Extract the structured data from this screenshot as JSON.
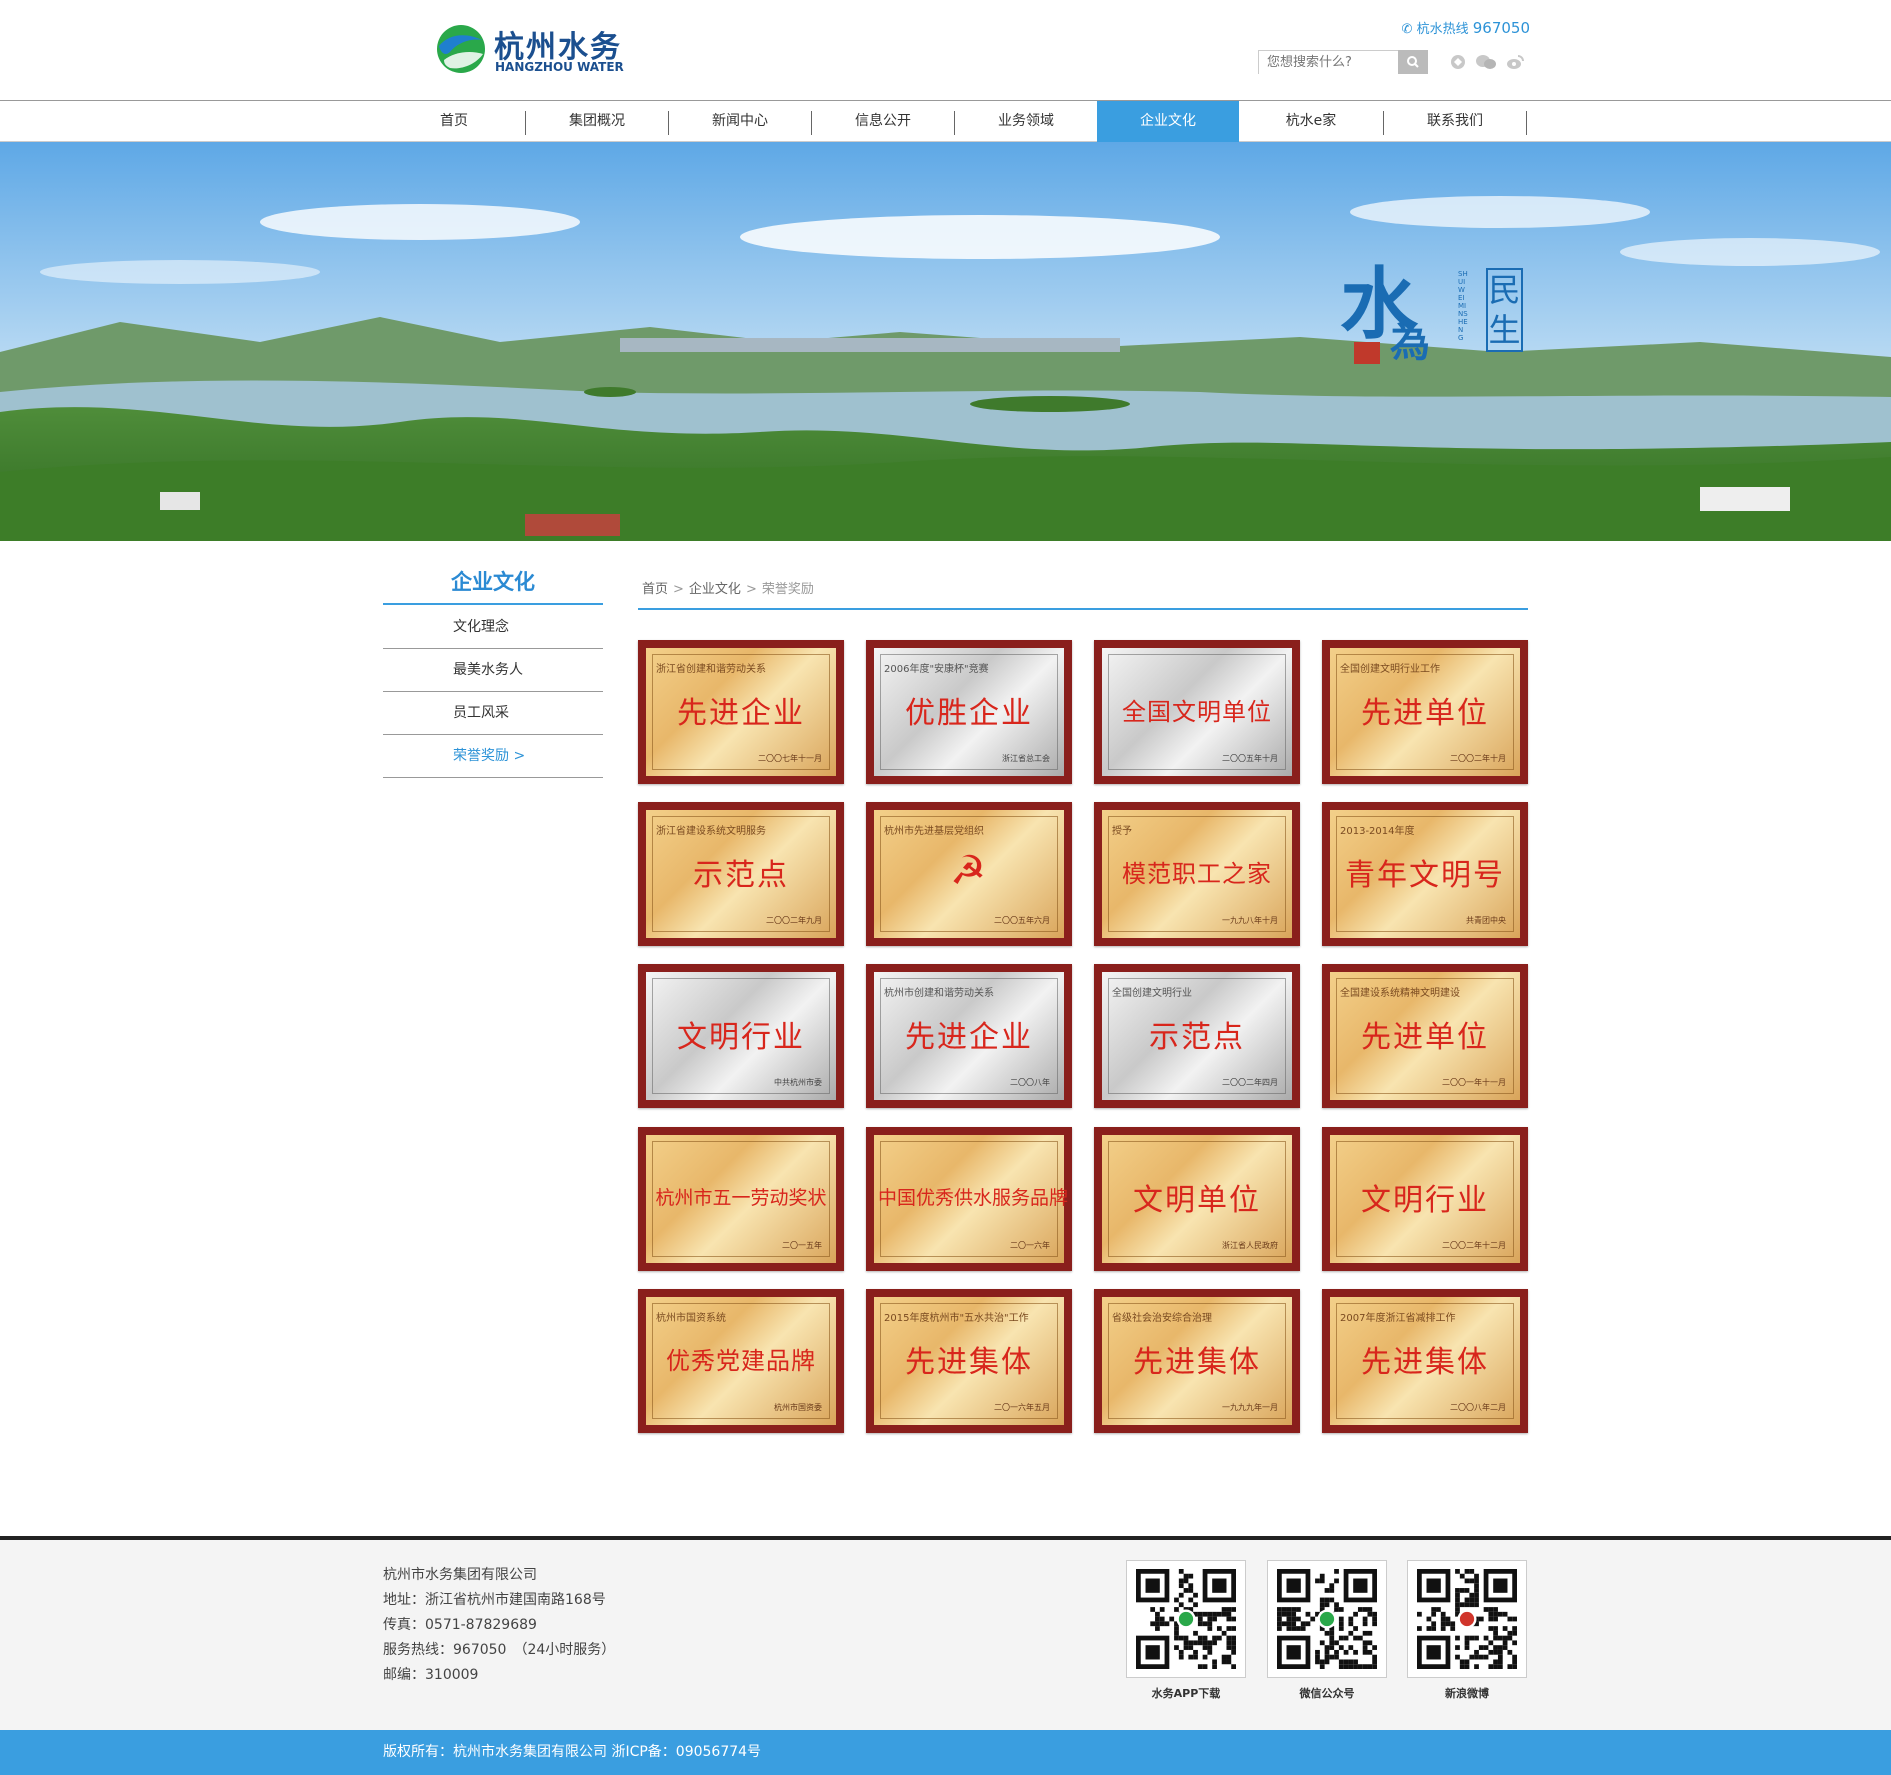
{
  "header": {
    "logo_cn": "杭州水务",
    "logo_en": "HANGZHOU WATER",
    "hotline_label": "杭水热线",
    "hotline_number": "967050",
    "search_placeholder": "您想搜索什么?",
    "accent_color": "#3a9ee0"
  },
  "nav": {
    "items": [
      {
        "label": "首页"
      },
      {
        "label": "集团概况"
      },
      {
        "label": "新闻中心"
      },
      {
        "label": "信息公开"
      },
      {
        "label": "业务领域"
      },
      {
        "label": "企业文化",
        "active": true
      },
      {
        "label": "杭水e家"
      },
      {
        "label": "联系我们"
      }
    ]
  },
  "banner": {
    "calligraphy_main": "水",
    "calligraphy_sub": "為",
    "calligraphy_side": "民生",
    "vertical_text": "SHUIWEI MINSHENG"
  },
  "sidebar": {
    "title": "企业文化",
    "items": [
      {
        "label": "文化理念"
      },
      {
        "label": "最美水务人"
      },
      {
        "label": "员工风采"
      },
      {
        "label": "荣誉奖励 >",
        "active": true
      }
    ]
  },
  "breadcrumb": {
    "home": "首页",
    "section": "企业文化",
    "current": "荣誉奖励",
    "separator": ">"
  },
  "awards": [
    {
      "top": "浙江省创建和谐劳动关系",
      "title": "先进企业",
      "sub": "二〇〇七年十一月",
      "style": "gold"
    },
    {
      "top": "2006年度\"安康杯\"竞赛",
      "title": "优胜企业",
      "sub": "浙江省总工会",
      "style": "silver"
    },
    {
      "top": "",
      "title": "全国文明单位",
      "sub": "二〇〇五年十月",
      "style": "silver"
    },
    {
      "top": "全国创建文明行业工作",
      "title": "先进单位",
      "sub": "二〇〇二年十月",
      "style": "gold"
    },
    {
      "top": "浙江省建设系统文明服务",
      "title": "示范点",
      "sub": "二〇〇二年九月",
      "style": "gold"
    },
    {
      "top": "杭州市先进基层党组织",
      "title": "☭",
      "sub": "二〇〇五年六月",
      "style": "gold"
    },
    {
      "top": "授予",
      "title": "模范职工之家",
      "sub": "一九九八年十月",
      "style": "gold"
    },
    {
      "top": "2013-2014年度",
      "title": "青年文明号",
      "sub": "共青团中央",
      "style": "gold"
    },
    {
      "top": "",
      "title": "文明行业",
      "sub": "中共杭州市委",
      "style": "silver"
    },
    {
      "top": "杭州市创建和谐劳动关系",
      "title": "先进企业",
      "sub": "二〇〇八年",
      "style": "silver"
    },
    {
      "top": "全国创建文明行业",
      "title": "示范点",
      "sub": "二〇〇二年四月",
      "style": "silver"
    },
    {
      "top": "全国建设系统精神文明建设",
      "title": "先进单位",
      "sub": "二〇〇一年十一月",
      "style": "gold"
    },
    {
      "top": "",
      "title": "杭州市五一劳动奖状",
      "sub": "二〇一五年",
      "style": "gold"
    },
    {
      "top": "",
      "title": "中国优秀供水服务品牌",
      "sub": "二〇一六年",
      "style": "gold"
    },
    {
      "top": "",
      "title": "文明单位",
      "sub": "浙江省人民政府",
      "style": "gold"
    },
    {
      "top": "",
      "title": "文明行业",
      "sub": "二〇〇二年十二月",
      "style": "gold"
    },
    {
      "top": "杭州市国资系统",
      "title": "优秀党建品牌",
      "sub": "杭州市国资委",
      "style": "gold"
    },
    {
      "top": "2015年度杭州市\"五水共治\"工作",
      "title": "先进集体",
      "sub": "二〇一六年五月",
      "style": "gold"
    },
    {
      "top": "省级社会治安综合治理",
      "title": "先进集体",
      "sub": "一九九九年一月",
      "style": "gold"
    },
    {
      "top": "2007年度浙江省减排工作",
      "title": "先进集体",
      "sub": "二〇〇八年二月",
      "style": "gold"
    }
  ],
  "footer": {
    "company": "杭州市水务集团有限公司",
    "address": "地址：浙江省杭州市建国南路168号",
    "fax": "传真：0571-87829689",
    "service": "服务热线：967050　（24小时服务）",
    "postcode": "邮编：310009",
    "qr_codes": [
      {
        "label": "水务APP下载"
      },
      {
        "label": "微信公众号"
      },
      {
        "label": "新浪微博"
      }
    ],
    "copyright": "版权所有：杭州市水务集团有限公司 浙ICP备：09056774号"
  }
}
